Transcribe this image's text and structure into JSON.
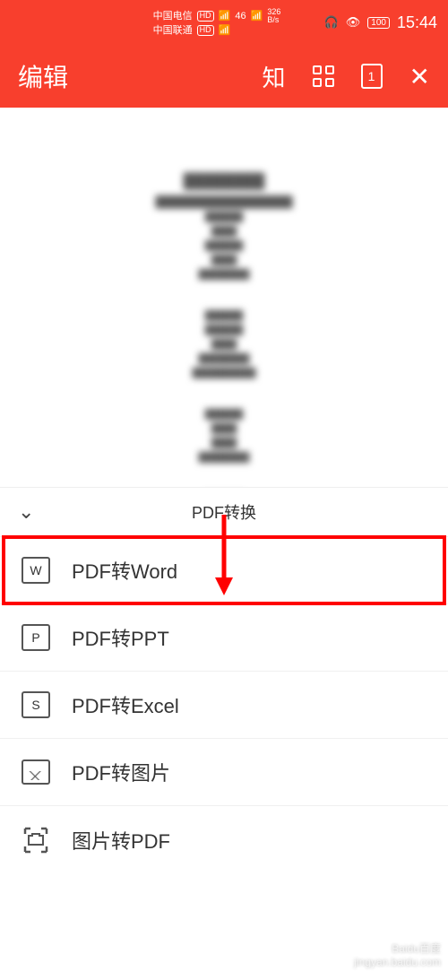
{
  "status": {
    "carrier1": "中国电信",
    "carrier2": "中国联通",
    "hd_label": "HD",
    "signal_label": "46",
    "speed": "326",
    "speed_unit": "B/s",
    "battery": "100",
    "time": "15:44"
  },
  "header": {
    "title": "编辑",
    "zhi_label": "知",
    "page_number": "1"
  },
  "sheet": {
    "title": "PDF转换",
    "items": [
      {
        "icon": "W",
        "icon_name": "word-icon",
        "label": "PDF转Word"
      },
      {
        "icon": "P",
        "icon_name": "ppt-icon",
        "label": "PDF转PPT"
      },
      {
        "icon": "S",
        "icon_name": "excel-icon",
        "label": "PDF转Excel"
      },
      {
        "icon": "",
        "icon_name": "image-icon",
        "label": "PDF转图片"
      },
      {
        "icon": "",
        "icon_name": "scan-icon",
        "label": "图片转PDF"
      }
    ]
  },
  "watermark": {
    "line1": "Baidu百度",
    "line2": "jingyan.baidu.com"
  }
}
